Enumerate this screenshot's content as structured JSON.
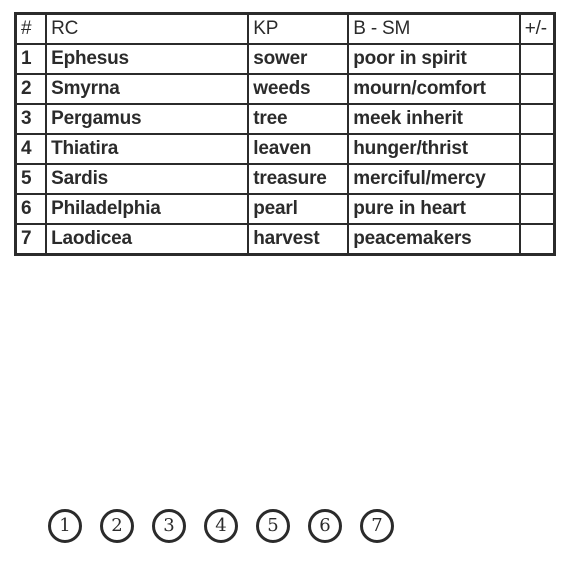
{
  "page": {
    "background_color": "#ffffff",
    "ink_color": "#2b2b2b"
  },
  "table": {
    "columns": [
      {
        "key": "num",
        "header": "#"
      },
      {
        "key": "rc",
        "header": "RC"
      },
      {
        "key": "kp",
        "header": "KP"
      },
      {
        "key": "bsm",
        "header": "B - SM"
      },
      {
        "key": "pm",
        "header": "+/-"
      }
    ],
    "rows": [
      {
        "num": "1",
        "rc": "Ephesus",
        "kp": "sower",
        "bsm": "poor in spirit",
        "pm": ""
      },
      {
        "num": "2",
        "rc": "Smyrna",
        "kp": "weeds",
        "bsm": "mourn/comfort",
        "pm": ""
      },
      {
        "num": "3",
        "rc": "Pergamus",
        "kp": "tree",
        "bsm": "meek inherit",
        "pm": ""
      },
      {
        "num": "4",
        "rc": "Thiatira",
        "kp": "leaven",
        "bsm": "hunger/thrist",
        "pm": ""
      },
      {
        "num": "5",
        "rc": "Sardis",
        "kp": "treasure",
        "bsm": "merciful/mercy",
        "pm": ""
      },
      {
        "num": "6",
        "rc": "Philadelphia",
        "kp": "pearl",
        "bsm": "pure in heart",
        "pm": ""
      },
      {
        "num": "7",
        "rc": "Laodicea",
        "kp": "harvest",
        "bsm": "peacemakers",
        "pm": ""
      }
    ]
  },
  "circle_numbers": {
    "items": [
      {
        "label": "1"
      },
      {
        "label": "2"
      },
      {
        "label": "3"
      },
      {
        "label": "4"
      },
      {
        "label": "5"
      },
      {
        "label": "6"
      },
      {
        "label": "7"
      }
    ]
  }
}
